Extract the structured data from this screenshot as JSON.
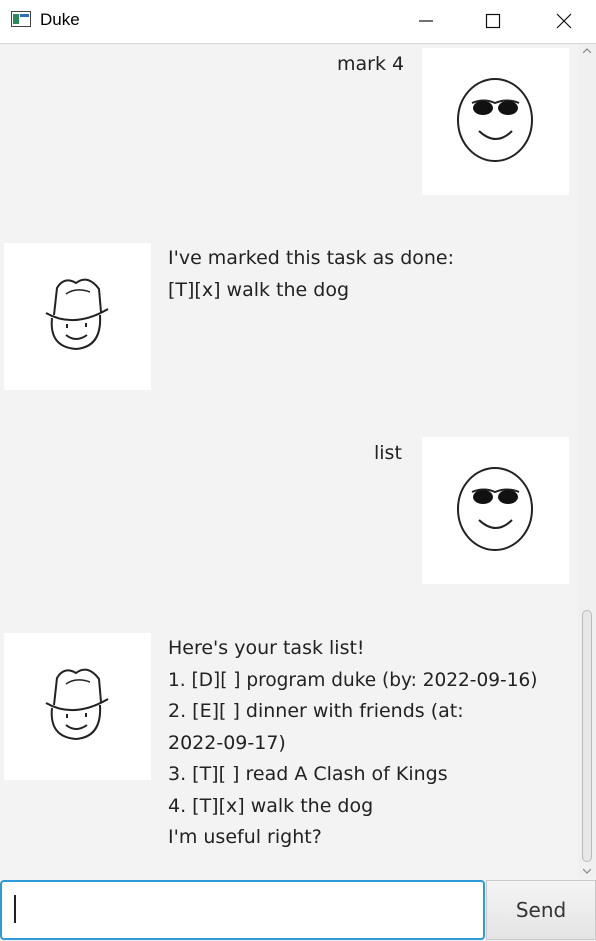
{
  "window": {
    "title": "Duke"
  },
  "dialog": {
    "user_1": "mark 4",
    "duke_1": [
      "I've marked this task as done:",
      "[T][x] walk the dog"
    ],
    "user_2": "list",
    "duke_2": [
      "Here's your task list!",
      "1. [D][ ] program duke (by: 2022-09-16)",
      "2. [E][ ] dinner with friends (at:",
      "2022-09-17)",
      "3. [T][ ] read A Clash of Kings",
      "4. [T][x] walk the dog",
      "I'm useful right?"
    ]
  },
  "input": {
    "value": "",
    "placeholder": ""
  },
  "send_button": {
    "label": "Send"
  },
  "icons": {
    "app": "app-window-icon",
    "user_avatar": "sunglasses-smiley-icon",
    "duke_avatar": "hat-smiley-icon"
  },
  "colors": {
    "accent": "#2f9bd6",
    "dialog_bg": "#f3f3f3"
  }
}
